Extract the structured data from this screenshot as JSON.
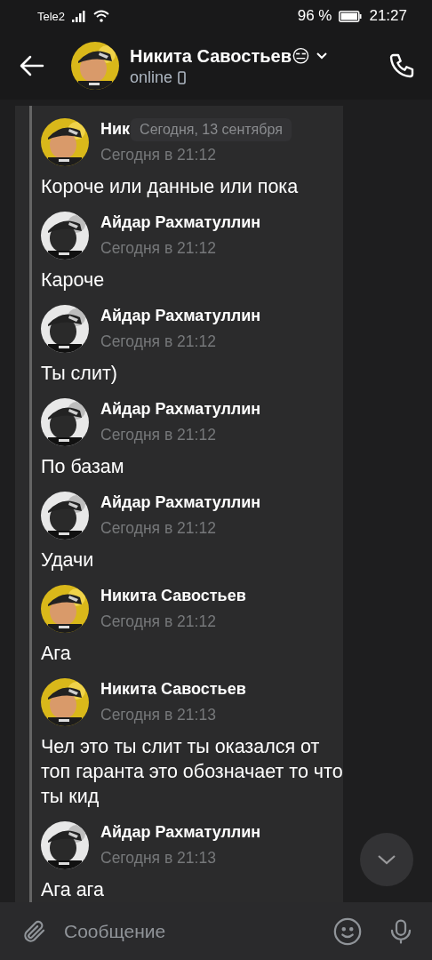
{
  "status_bar": {
    "carrier": "Tele2",
    "battery": "96 %",
    "time": "21:27"
  },
  "header": {
    "name": "Никита Савостьев",
    "emoji": "😑",
    "status": "online"
  },
  "date_pill": "Сегодня, 13 сентября",
  "messages": [
    {
      "author": "Ник",
      "time": "Сегодня в 21:12",
      "text": "Короче или данные или пока"
    },
    {
      "author": "Айдар Рахматуллин",
      "time": "Сегодня в 21:12",
      "text": "Кароче"
    },
    {
      "author": "Айдар Рахматуллин",
      "time": "Сегодня в 21:12",
      "text": "Ты слит)"
    },
    {
      "author": "Айдар Рахматуллин",
      "time": "Сегодня в 21:12",
      "text": "По базам"
    },
    {
      "author": "Айдар Рахматуллин",
      "time": "Сегодня в 21:12",
      "text": "Удачи"
    },
    {
      "author": "Никита Савостьев",
      "time": "Сегодня в 21:12",
      "text": "Ага"
    },
    {
      "author": "Никита Савостьев",
      "time": "Сегодня в 21:13",
      "text": "Чел это ты слит ты оказался от топ гаранта это обозначает то что ты кид"
    },
    {
      "author": "Айдар Рахматуллин",
      "time": "Сегодня в 21:13",
      "text": "Ага ага"
    }
  ],
  "composer": {
    "placeholder": "Сообщение"
  }
}
